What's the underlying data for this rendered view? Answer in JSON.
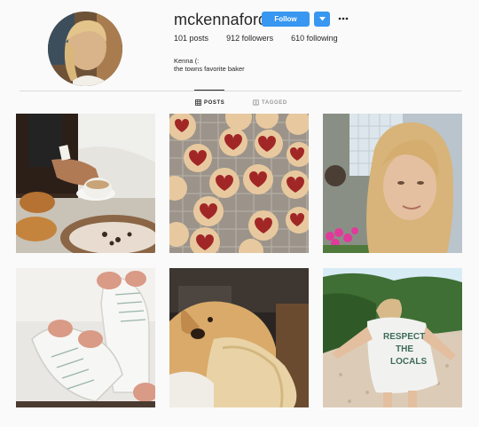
{
  "profile": {
    "username": "mckennaford",
    "follow_label": "Follow",
    "posts_count": "101",
    "posts_label": "posts",
    "followers_count": "912",
    "followers_label": "followers",
    "following_count": "610",
    "following_label": "following",
    "full_name": "Kenna (:",
    "bio": "the towns favorite baker"
  },
  "tabs": [
    {
      "label": "POSTS",
      "icon": "grid-icon",
      "active": true
    },
    {
      "label": "TAGGED",
      "icon": "tag-icon",
      "active": false
    }
  ],
  "posts": [
    {
      "subject": "cafe-pastries-coffee-photo"
    },
    {
      "subject": "heart-jam-cookies-photo"
    },
    {
      "subject": "selfie-blonde-photo"
    },
    {
      "subject": "roller-skates-photo"
    },
    {
      "subject": "golden-retriever-photo"
    },
    {
      "subject": "beach-respect-the-locals-photo"
    }
  ],
  "post_artwork_text": "RESPECT THE LOCALS",
  "colors": {
    "accent": "#3897f0",
    "text": "#262626",
    "muted": "#999999",
    "background": "#fafafa",
    "divider": "#dbdbdb"
  }
}
